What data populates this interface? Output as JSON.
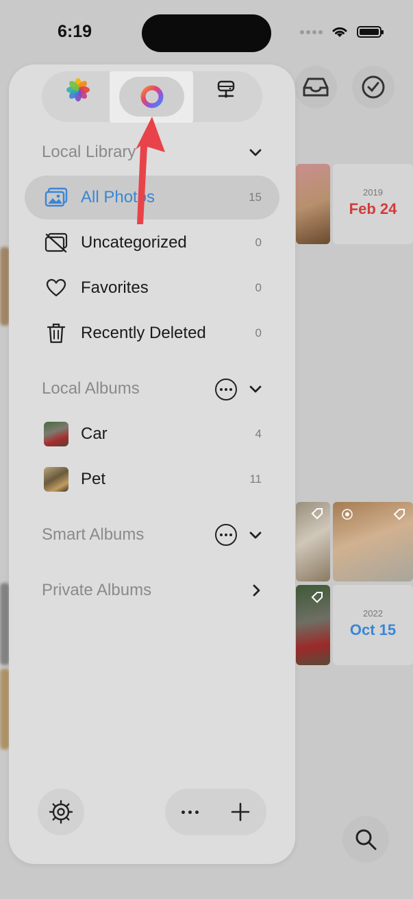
{
  "status_bar": {
    "time": "6:19"
  },
  "header": {
    "tabs": [
      {
        "name": "photos-app-icon"
      },
      {
        "name": "colorful-ring-icon",
        "selected": true
      },
      {
        "name": "network-drive-icon"
      }
    ]
  },
  "local_library": {
    "title": "Local Library",
    "items": [
      {
        "label": "All Photos",
        "count": "15",
        "icon": "photos-icon",
        "active": true
      },
      {
        "label": "Uncategorized",
        "count": "0",
        "icon": "uncategorized-icon"
      },
      {
        "label": "Favorites",
        "count": "0",
        "icon": "heart-icon"
      },
      {
        "label": "Recently Deleted",
        "count": "0",
        "icon": "trash-icon"
      }
    ]
  },
  "local_albums": {
    "title": "Local Albums",
    "items": [
      {
        "label": "Car",
        "count": "4"
      },
      {
        "label": "Pet",
        "count": "11"
      }
    ]
  },
  "smart_albums": {
    "title": "Smart Albums"
  },
  "private_albums": {
    "title": "Private Albums"
  },
  "background": {
    "date1": {
      "year": "2019",
      "day": "Feb 24",
      "color": "#d23b3b"
    },
    "date2": {
      "year": "2022",
      "day": "Oct 15",
      "color": "#3a86d6"
    }
  },
  "colors": {
    "accent": "#3a86d6",
    "arrow": "#e8434a"
  }
}
